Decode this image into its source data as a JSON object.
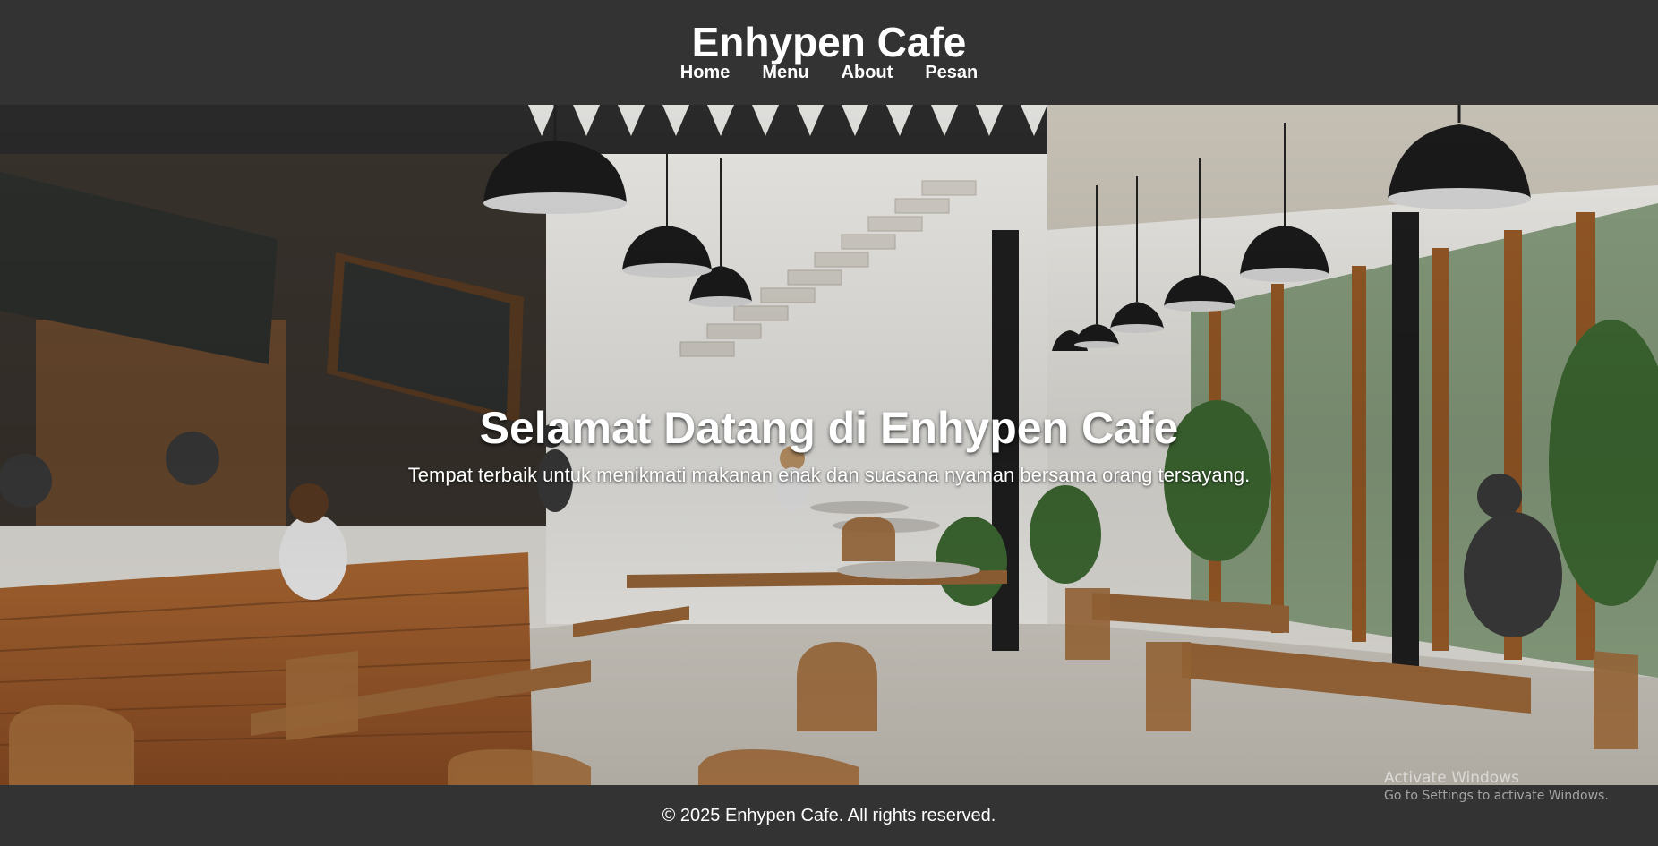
{
  "site": {
    "title": "Enhypen Cafe",
    "nav": [
      "Home",
      "Menu",
      "About",
      "Pesan"
    ]
  },
  "hero": {
    "heading": "Selamat Datang di Enhypen Cafe",
    "subheading": "Tempat terbaik untuk menikmati makanan enak dan suasana nyaman bersama orang tersayang.",
    "image": "cafe-interior-photo"
  },
  "footer": {
    "text": "© 2025 Enhypen Cafe. All rights reserved."
  },
  "os_overlay": {
    "line1": "Activate Windows",
    "line2": "Go to Settings to activate Windows."
  },
  "colors": {
    "header_bg": "#333333",
    "footer_bg": "#333333",
    "text": "#ffffff"
  }
}
